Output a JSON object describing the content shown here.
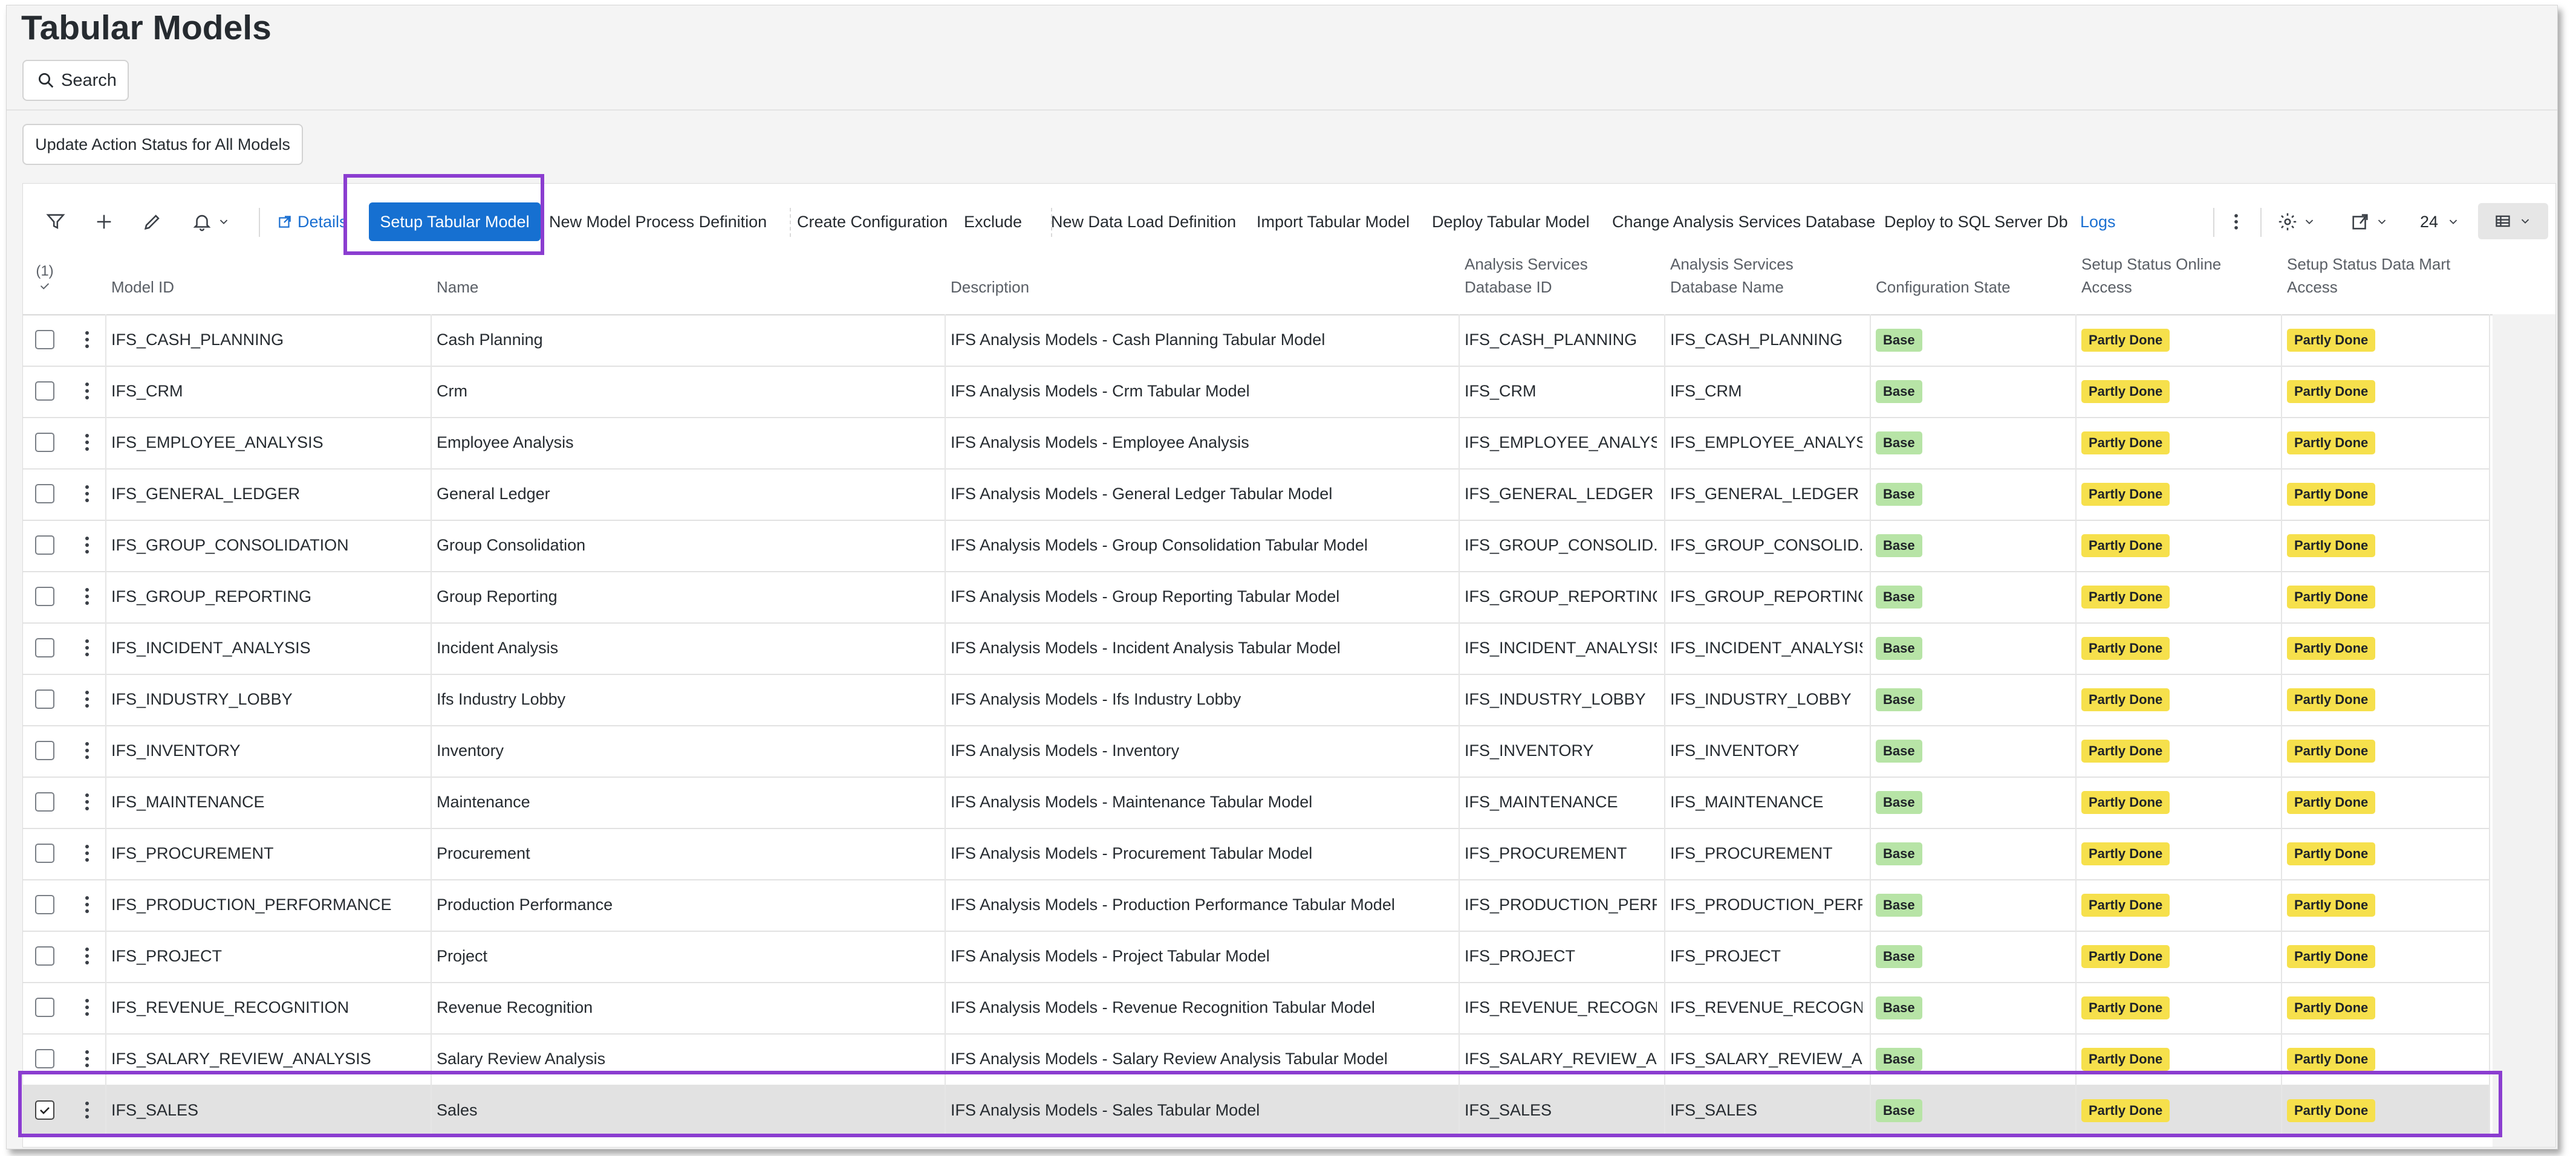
{
  "page": {
    "title": "Tabular Models"
  },
  "search": {
    "label": "Search"
  },
  "actions": {
    "update_all": "Update Action Status for All Models"
  },
  "toolbar": {
    "filter_icon": "filter-icon",
    "add_icon": "plus-icon",
    "edit_icon": "pencil-icon",
    "notify_icon": "bell-icon",
    "details": "Details",
    "setup": "Setup Tabular Model",
    "new_process": "New Model Process Definition",
    "create_config": "Create Configuration",
    "exclude": "Exclude",
    "new_data_load": "New Data Load Definition",
    "import": "Import Tabular Model",
    "deploy": "Deploy Tabular Model",
    "change_db": "Change Analysis Services Database",
    "deploy_sql": "Deploy to SQL Server Db",
    "logs": "Logs",
    "page_size": "24"
  },
  "table": {
    "selected_count": "(1)",
    "columns": {
      "model_id": "Model ID",
      "name": "Name",
      "description": "Description",
      "db_id_1": "Analysis Services",
      "db_id_2": "Database ID",
      "db_name_1": "Analysis Services",
      "db_name_2": "Database Name",
      "config_state": "Configuration State",
      "online_1": "Setup Status Online",
      "online_2": "Access",
      "datamart_1": "Setup Status Data Mart",
      "datamart_2": "Access"
    },
    "rows": [
      {
        "id": "IFS_CASH_PLANNING",
        "name": "Cash Planning",
        "desc": "IFS Analysis Models - Cash Planning Tabular Model",
        "dbid": "IFS_CASH_PLANNING",
        "dbname": "IFS_CASH_PLANNING",
        "state": "Base",
        "online": "Partly Done",
        "mart": "Partly Done",
        "selected": false
      },
      {
        "id": "IFS_CRM",
        "name": "Crm",
        "desc": "IFS Analysis Models - Crm Tabular Model",
        "dbid": "IFS_CRM",
        "dbname": "IFS_CRM",
        "state": "Base",
        "online": "Partly Done",
        "mart": "Partly Done",
        "selected": false
      },
      {
        "id": "IFS_EMPLOYEE_ANALYSIS",
        "name": "Employee Analysis",
        "desc": "IFS Analysis Models - Employee Analysis",
        "dbid": "IFS_EMPLOYEE_ANALYSIS",
        "dbname": "IFS_EMPLOYEE_ANALYSIS",
        "state": "Base",
        "online": "Partly Done",
        "mart": "Partly Done",
        "selected": false
      },
      {
        "id": "IFS_GENERAL_LEDGER",
        "name": "General Ledger",
        "desc": "IFS Analysis Models - General Ledger Tabular Model",
        "dbid": "IFS_GENERAL_LEDGER",
        "dbname": "IFS_GENERAL_LEDGER",
        "state": "Base",
        "online": "Partly Done",
        "mart": "Partly Done",
        "selected": false
      },
      {
        "id": "IFS_GROUP_CONSOLIDATION",
        "name": "Group Consolidation",
        "desc": "IFS Analysis Models - Group Consolidation Tabular Model",
        "dbid": "IFS_GROUP_CONSOLID...",
        "dbname": "IFS_GROUP_CONSOLID...",
        "state": "Base",
        "online": "Partly Done",
        "mart": "Partly Done",
        "selected": false
      },
      {
        "id": "IFS_GROUP_REPORTING",
        "name": "Group Reporting",
        "desc": "IFS Analysis Models - Group Reporting Tabular Model",
        "dbid": "IFS_GROUP_REPORTING",
        "dbname": "IFS_GROUP_REPORTING",
        "state": "Base",
        "online": "Partly Done",
        "mart": "Partly Done",
        "selected": false
      },
      {
        "id": "IFS_INCIDENT_ANALYSIS",
        "name": "Incident Analysis",
        "desc": "IFS Analysis Models - Incident Analysis Tabular Model",
        "dbid": "IFS_INCIDENT_ANALYSIS",
        "dbname": "IFS_INCIDENT_ANALYSIS",
        "state": "Base",
        "online": "Partly Done",
        "mart": "Partly Done",
        "selected": false
      },
      {
        "id": "IFS_INDUSTRY_LOBBY",
        "name": "Ifs Industry Lobby",
        "desc": "IFS Analysis Models - Ifs Industry Lobby",
        "dbid": "IFS_INDUSTRY_LOBBY",
        "dbname": "IFS_INDUSTRY_LOBBY",
        "state": "Base",
        "online": "Partly Done",
        "mart": "Partly Done",
        "selected": false
      },
      {
        "id": "IFS_INVENTORY",
        "name": "Inventory",
        "desc": "IFS Analysis Models - Inventory",
        "dbid": "IFS_INVENTORY",
        "dbname": "IFS_INVENTORY",
        "state": "Base",
        "online": "Partly Done",
        "mart": "Partly Done",
        "selected": false
      },
      {
        "id": "IFS_MAINTENANCE",
        "name": "Maintenance",
        "desc": "IFS Analysis Models - Maintenance Tabular Model",
        "dbid": "IFS_MAINTENANCE",
        "dbname": "IFS_MAINTENANCE",
        "state": "Base",
        "online": "Partly Done",
        "mart": "Partly Done",
        "selected": false
      },
      {
        "id": "IFS_PROCUREMENT",
        "name": "Procurement",
        "desc": "IFS Analysis Models - Procurement Tabular Model",
        "dbid": "IFS_PROCUREMENT",
        "dbname": "IFS_PROCUREMENT",
        "state": "Base",
        "online": "Partly Done",
        "mart": "Partly Done",
        "selected": false
      },
      {
        "id": "IFS_PRODUCTION_PERFORMANCE",
        "name": "Production Performance",
        "desc": "IFS Analysis Models - Production Performance Tabular Model",
        "dbid": "IFS_PRODUCTION_PERF...",
        "dbname": "IFS_PRODUCTION_PERF...",
        "state": "Base",
        "online": "Partly Done",
        "mart": "Partly Done",
        "selected": false
      },
      {
        "id": "IFS_PROJECT",
        "name": "Project",
        "desc": "IFS Analysis Models - Project Tabular Model",
        "dbid": "IFS_PROJECT",
        "dbname": "IFS_PROJECT",
        "state": "Base",
        "online": "Partly Done",
        "mart": "Partly Done",
        "selected": false
      },
      {
        "id": "IFS_REVENUE_RECOGNITION",
        "name": "Revenue Recognition",
        "desc": "IFS Analysis Models - Revenue Recognition Tabular Model",
        "dbid": "IFS_REVENUE_RECOGNI...",
        "dbname": "IFS_REVENUE_RECOGNI...",
        "state": "Base",
        "online": "Partly Done",
        "mart": "Partly Done",
        "selected": false
      },
      {
        "id": "IFS_SALARY_REVIEW_ANALYSIS",
        "name": "Salary Review Analysis",
        "desc": "IFS Analysis Models - Salary Review Analysis Tabular Model",
        "dbid": "IFS_SALARY_REVIEW_AN...",
        "dbname": "IFS_SALARY_REVIEW_AN...",
        "state": "Base",
        "online": "Partly Done",
        "mart": "Partly Done",
        "selected": false
      },
      {
        "id": "IFS_SALES",
        "name": "Sales",
        "desc": "IFS Analysis Models - Sales Tabular Model",
        "dbid": "IFS_SALES",
        "dbname": "IFS_SALES",
        "state": "Base",
        "online": "Partly Done",
        "mart": "Partly Done",
        "selected": true
      }
    ]
  },
  "colors": {
    "accent": "#1670d1",
    "highlight": "#8b3dd0",
    "badge_green": "#b7e4a6",
    "badge_yellow": "#f6e04c"
  }
}
